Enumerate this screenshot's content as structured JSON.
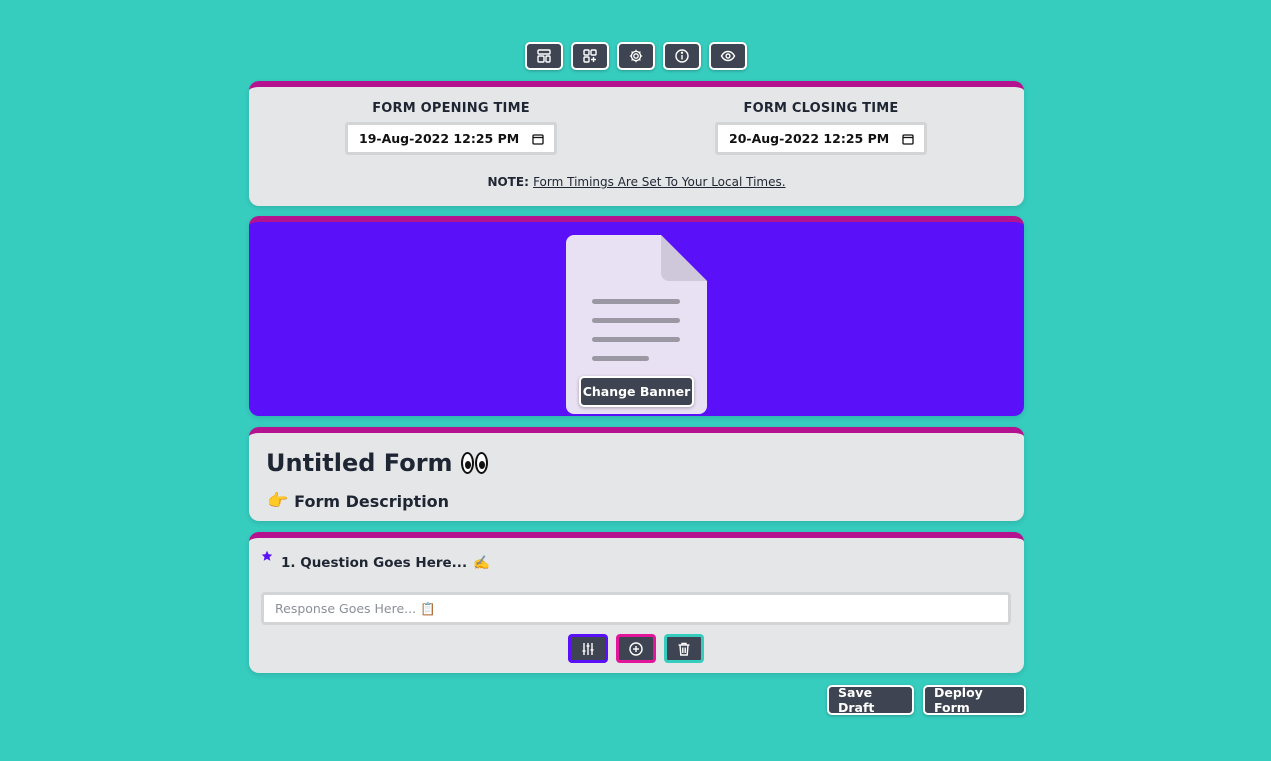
{
  "toolbar": {
    "items": [
      {
        "icon": "layout-icon"
      },
      {
        "icon": "add-block-icon"
      },
      {
        "icon": "gear-icon"
      },
      {
        "icon": "info-icon"
      },
      {
        "icon": "eye-icon"
      }
    ]
  },
  "timing": {
    "opening_label": "FORM OPENING TIME",
    "opening_value": "19-Aug-2022 12:25 PM",
    "closing_label": "FORM CLOSING TIME",
    "closing_value": "20-Aug-2022 12:25 PM",
    "note_label": "NOTE:",
    "note_text": "Form Timings Are Set To Your Local Times."
  },
  "banner": {
    "change_label": "Change Banner",
    "background": "#5a10f9"
  },
  "form": {
    "title": "Untitled Form",
    "description": "Form Description"
  },
  "question": {
    "text": "1. Question Goes Here...",
    "response_placeholder": "Response Goes Here...",
    "required_star_color": "#5a10f9"
  },
  "actions": {
    "save_label": "Save Draft",
    "deploy_label": "Deploy Form"
  },
  "colors": {
    "page_bg": "#36cdbf",
    "card_bg": "#e5e6e7",
    "card_accent": "#b5128f",
    "button_bg": "#3f4452"
  }
}
